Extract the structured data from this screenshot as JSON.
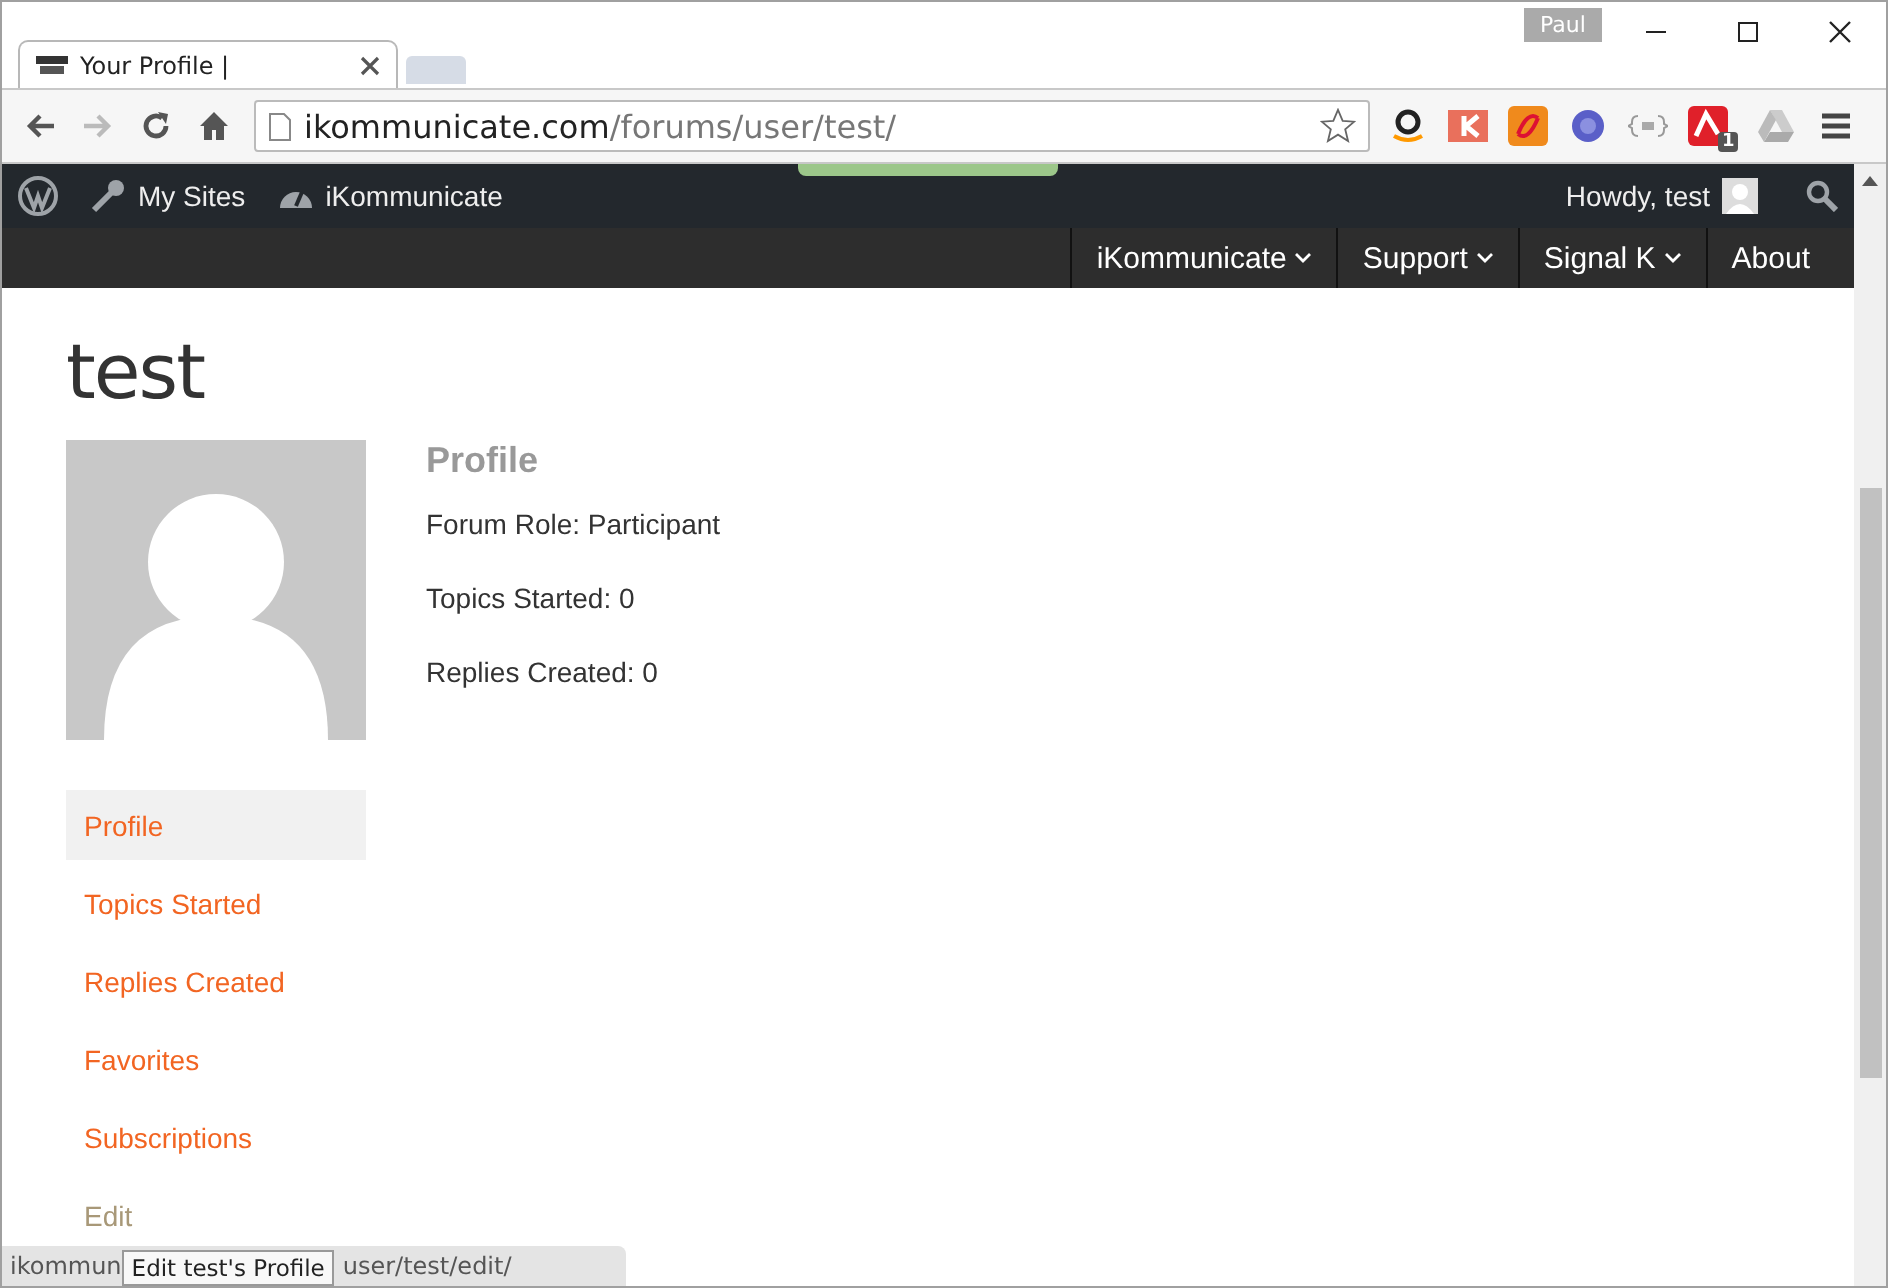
{
  "browser": {
    "profile": "Paul",
    "tab": {
      "title": "Your Profile |"
    },
    "url": {
      "host": "ikommunicate.com",
      "path": "/forums/user/test/"
    },
    "extension_badge": "1"
  },
  "admin_bar": {
    "items": [
      "My Sites",
      "iKommunicate"
    ],
    "greeting": "Howdy, test"
  },
  "nav": {
    "items": [
      {
        "label": "iKommunicate",
        "dropdown": true
      },
      {
        "label": "Support",
        "dropdown": true
      },
      {
        "label": "Signal K",
        "dropdown": true
      },
      {
        "label": "About",
        "dropdown": false
      }
    ]
  },
  "page": {
    "title": "test",
    "section_title": "Profile",
    "details": [
      "Forum Role: Participant",
      "Topics Started: 0",
      "Replies Created: 0"
    ]
  },
  "sidebar": {
    "items": [
      {
        "label": "Profile",
        "selected": true,
        "hovered": false
      },
      {
        "label": "Topics Started",
        "selected": false,
        "hovered": false
      },
      {
        "label": "Replies Created",
        "selected": false,
        "hovered": false
      },
      {
        "label": "Favorites",
        "selected": false,
        "hovered": false
      },
      {
        "label": "Subscriptions",
        "selected": false,
        "hovered": false
      },
      {
        "label": "Edit",
        "selected": false,
        "hovered": true
      }
    ]
  },
  "status_bar": {
    "text_start": "ikommun",
    "text_end": "user/test/edit/"
  },
  "tooltip": "Edit test's Profile"
}
